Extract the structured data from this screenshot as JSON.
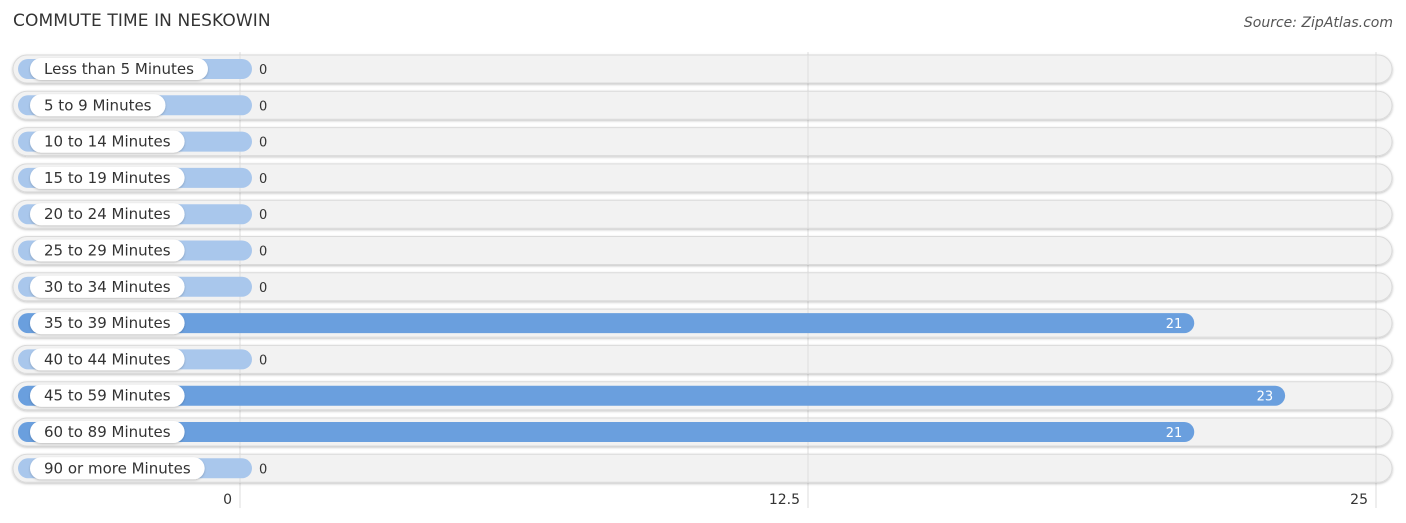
{
  "chart_data": {
    "type": "bar",
    "orientation": "horizontal",
    "title": "COMMUTE TIME IN NESKOWIN",
    "source": "Source: ZipAtlas.com",
    "xlabel": "",
    "ylabel": "",
    "xlim": [
      0,
      25
    ],
    "ticks": [
      {
        "value": 0,
        "label": "0"
      },
      {
        "value": 12.5,
        "label": "12.5"
      },
      {
        "value": 25,
        "label": "25"
      }
    ],
    "grid": true,
    "categories": [
      "Less than 5 Minutes",
      "5 to 9 Minutes",
      "10 to 14 Minutes",
      "15 to 19 Minutes",
      "20 to 24 Minutes",
      "25 to 29 Minutes",
      "30 to 34 Minutes",
      "35 to 39 Minutes",
      "40 to 44 Minutes",
      "45 to 59 Minutes",
      "60 to 89 Minutes",
      "90 or more Minutes"
    ],
    "values": [
      0,
      0,
      0,
      0,
      0,
      0,
      0,
      21,
      0,
      23,
      21,
      0
    ],
    "value_labels": [
      "0",
      "0",
      "0",
      "0",
      "0",
      "0",
      "0",
      "21",
      "0",
      "23",
      "21",
      "0"
    ],
    "colors": {
      "bar": "#6a9fde",
      "bar_zero": "#a9c7ec",
      "track": "#f2f2f2",
      "grid": "#dddddd"
    }
  }
}
